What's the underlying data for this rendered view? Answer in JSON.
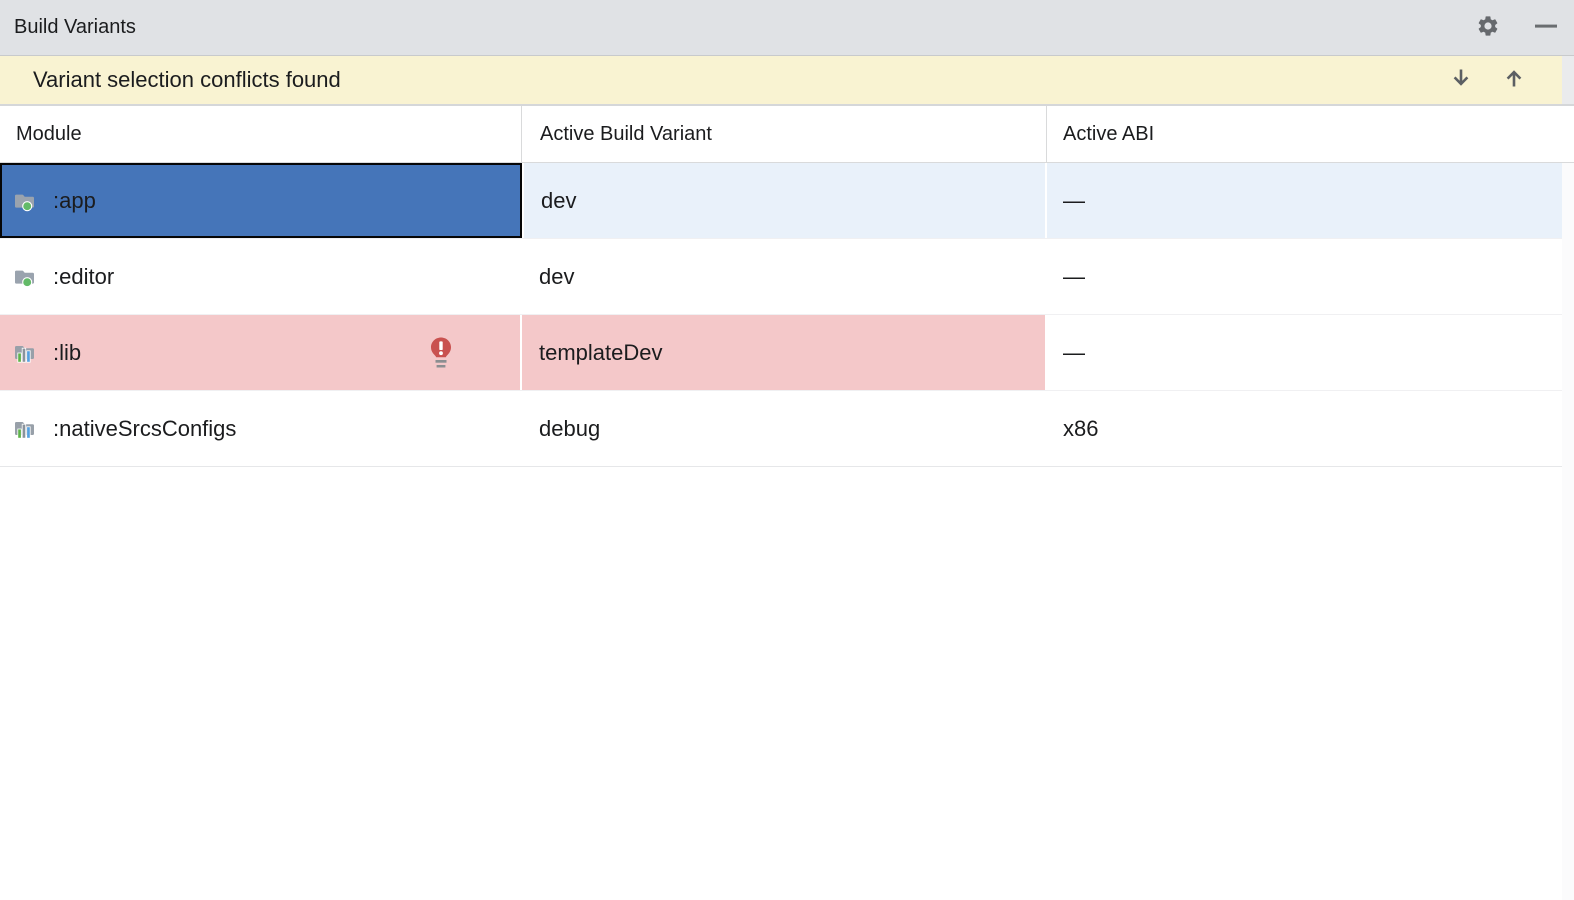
{
  "titlebar": {
    "title": "Build Variants",
    "settings_button": "settings",
    "minimize_button": "hide"
  },
  "banner": {
    "message": "Variant selection conflicts found",
    "next_conflict_button": "next conflict",
    "previous_conflict_button": "previous conflict"
  },
  "table": {
    "columns": [
      {
        "label": "Module"
      },
      {
        "label": "Active Build Variant"
      },
      {
        "label": "Active ABI"
      }
    ],
    "rows": [
      {
        "module": ":app",
        "variant": "dev",
        "abi": "—",
        "icon": "android-module-icon",
        "selected": true,
        "conflict": false
      },
      {
        "module": ":editor",
        "variant": "dev",
        "abi": "—",
        "icon": "android-module-icon",
        "selected": false,
        "conflict": false
      },
      {
        "module": ":lib",
        "variant": "templateDev",
        "abi": "—",
        "icon": "library-module-icon",
        "selected": false,
        "conflict": true
      },
      {
        "module": ":nativeSrcsConfigs",
        "variant": "debug",
        "abi": "x86",
        "icon": "library-module-icon",
        "selected": false,
        "conflict": false
      }
    ]
  },
  "colors": {
    "titlebar_bg": "#E0E2E5",
    "banner_bg": "#F9F3D2",
    "selection_blue": "#4575B9",
    "selection_row_tint": "#E9F1FA",
    "conflict_pink": "#F4C8C9",
    "text": "#1B1C1E",
    "icon_gray": "#66696D",
    "bulb_red": "#C9514F"
  }
}
